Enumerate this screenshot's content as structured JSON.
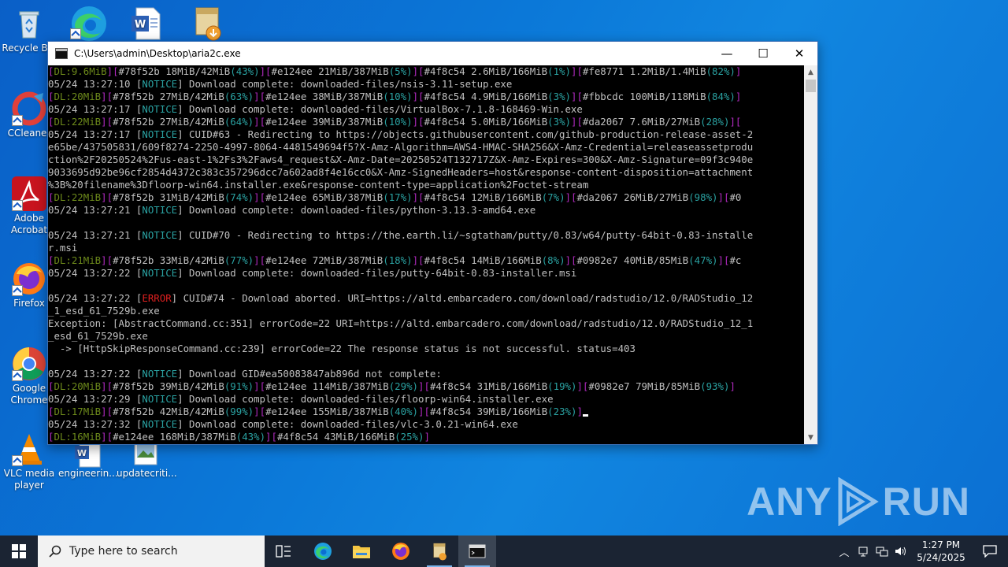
{
  "desktop_icons": [
    {
      "label": "Recycle Bin",
      "icon": "recycle-bin-icon"
    },
    {
      "label": "CCleaner",
      "icon": "ccleaner-icon"
    },
    {
      "label": "Adobe Acrobat",
      "icon": "adobe-acrobat-icon"
    },
    {
      "label": "Firefox",
      "icon": "firefox-icon"
    },
    {
      "label": "Google Chrome",
      "icon": "chrome-icon"
    },
    {
      "label": "VLC media player",
      "icon": "vlc-icon"
    },
    {
      "label": "engineerin...",
      "icon": "word-document-icon"
    },
    {
      "label": "updatecriti...",
      "icon": "image-file-icon"
    },
    {
      "label": "",
      "icon": "edge-icon"
    },
    {
      "label": "",
      "icon": "word-document-icon"
    },
    {
      "label": "",
      "icon": "installer-icon"
    }
  ],
  "window": {
    "title": "C:\\Users\\admin\\Desktop\\aria2c.exe",
    "minimize": "—",
    "maximize": "☐",
    "close": "✕"
  },
  "console_lines": [
    [
      [
        "sep",
        "["
      ],
      [
        "dl",
        "DL:9.6MiB"
      ],
      [
        "sep",
        "]["
      ],
      [
        "w",
        "#78f52b 18MiB/42MiB"
      ],
      [
        "g",
        "(43%)"
      ],
      [
        "sep",
        "]["
      ],
      [
        "w",
        "#e124ee 21MiB/387MiB"
      ],
      [
        "g",
        "(5%)"
      ],
      [
        "sep",
        "]["
      ],
      [
        "w",
        "#4f8c54 2.6MiB/166MiB"
      ],
      [
        "g",
        "(1%)"
      ],
      [
        "sep",
        "]["
      ],
      [
        "w",
        "#fe8771 1.2MiB/1.4MiB"
      ],
      [
        "g",
        "(82%)"
      ],
      [
        "sep",
        "]"
      ]
    ],
    [
      [
        "w",
        "05/24 13:27:10 ["
      ],
      [
        "tag",
        "NOTICE"
      ],
      [
        "w",
        "] Download complete: downloaded-files/nsis-3.11-setup.exe"
      ]
    ],
    [
      [
        "sep",
        "["
      ],
      [
        "dl",
        "DL:20MiB"
      ],
      [
        "sep",
        "]["
      ],
      [
        "w",
        "#78f52b 27MiB/42MiB"
      ],
      [
        "g",
        "(63%)"
      ],
      [
        "sep",
        "]["
      ],
      [
        "w",
        "#e124ee 38MiB/387MiB"
      ],
      [
        "g",
        "(10%)"
      ],
      [
        "sep",
        "]["
      ],
      [
        "w",
        "#4f8c54 4.9MiB/166MiB"
      ],
      [
        "g",
        "(3%)"
      ],
      [
        "sep",
        "]["
      ],
      [
        "w",
        "#fbbcdc 100MiB/118MiB"
      ],
      [
        "g",
        "(84%)"
      ],
      [
        "sep",
        "]"
      ]
    ],
    [
      [
        "w",
        "05/24 13:27:17 ["
      ],
      [
        "tag",
        "NOTICE"
      ],
      [
        "w",
        "] Download complete: downloaded-files/VirtualBox-7.1.8-168469-Win.exe"
      ]
    ],
    [
      [
        "sep",
        "["
      ],
      [
        "dl",
        "DL:22MiB"
      ],
      [
        "sep",
        "]["
      ],
      [
        "w",
        "#78f52b 27MiB/42MiB"
      ],
      [
        "g",
        "(64%)"
      ],
      [
        "sep",
        "]["
      ],
      [
        "w",
        "#e124ee 39MiB/387MiB"
      ],
      [
        "g",
        "(10%)"
      ],
      [
        "sep",
        "]["
      ],
      [
        "w",
        "#4f8c54 5.0MiB/166MiB"
      ],
      [
        "g",
        "(3%)"
      ],
      [
        "sep",
        "]["
      ],
      [
        "w",
        "#da2067 7.6MiB/27MiB"
      ],
      [
        "g",
        "(28%)"
      ],
      [
        "sep",
        "]["
      ]
    ],
    [
      [
        "w",
        "05/24 13:27:17 ["
      ],
      [
        "tag",
        "NOTICE"
      ],
      [
        "w",
        "] CUID#63 - Redirecting to https://objects.githubusercontent.com/github-production-release-asset-2"
      ]
    ],
    [
      [
        "w",
        "e65be/437505831/609f8274-2250-4997-8064-4481549694f5?X-Amz-Algorithm=AWS4-HMAC-SHA256&X-Amz-Credential=releaseassetprodu"
      ]
    ],
    [
      [
        "w",
        "ction%2F20250524%2Fus-east-1%2Fs3%2Faws4_request&X-Amz-Date=20250524T132717Z&X-Amz-Expires=300&X-Amz-Signature=09f3c940e"
      ]
    ],
    [
      [
        "w",
        "9033695d92be96cf2854d4372c383c357296dcc7a602ad8f4e16cc0&X-Amz-SignedHeaders=host&response-content-disposition=attachment"
      ]
    ],
    [
      [
        "w",
        "%3B%20filename%3Dfloorp-win64.installer.exe&response-content-type=application%2Foctet-stream"
      ]
    ],
    [
      [
        "sep",
        "["
      ],
      [
        "dl",
        "DL:22MiB"
      ],
      [
        "sep",
        "]["
      ],
      [
        "w",
        "#78f52b 31MiB/42MiB"
      ],
      [
        "g",
        "(74%)"
      ],
      [
        "sep",
        "]["
      ],
      [
        "w",
        "#e124ee 65MiB/387MiB"
      ],
      [
        "g",
        "(17%)"
      ],
      [
        "sep",
        "]["
      ],
      [
        "w",
        "#4f8c54 12MiB/166MiB"
      ],
      [
        "g",
        "(7%)"
      ],
      [
        "sep",
        "]["
      ],
      [
        "w",
        "#da2067 26MiB/27MiB"
      ],
      [
        "g",
        "(98%)"
      ],
      [
        "sep",
        "]["
      ],
      [
        "w",
        "#0"
      ]
    ],
    [
      [
        "w",
        "05/24 13:27:21 ["
      ],
      [
        "tag",
        "NOTICE"
      ],
      [
        "w",
        "] Download complete: downloaded-files/python-3.13.3-amd64.exe"
      ]
    ],
    [
      [
        "w",
        ""
      ]
    ],
    [
      [
        "w",
        "05/24 13:27:21 ["
      ],
      [
        "tag",
        "NOTICE"
      ],
      [
        "w",
        "] CUID#70 - Redirecting to https://the.earth.li/~sgtatham/putty/0.83/w64/putty-64bit-0.83-installe"
      ]
    ],
    [
      [
        "w",
        "r.msi"
      ]
    ],
    [
      [
        "sep",
        "["
      ],
      [
        "dl",
        "DL:21MiB"
      ],
      [
        "sep",
        "]["
      ],
      [
        "w",
        "#78f52b 33MiB/42MiB"
      ],
      [
        "g",
        "(77%)"
      ],
      [
        "sep",
        "]["
      ],
      [
        "w",
        "#e124ee 72MiB/387MiB"
      ],
      [
        "g",
        "(18%)"
      ],
      [
        "sep",
        "]["
      ],
      [
        "w",
        "#4f8c54 14MiB/166MiB"
      ],
      [
        "g",
        "(8%)"
      ],
      [
        "sep",
        "]["
      ],
      [
        "w",
        "#0982e7 40MiB/85MiB"
      ],
      [
        "g",
        "(47%)"
      ],
      [
        "sep",
        "]["
      ],
      [
        "w",
        "#c"
      ]
    ],
    [
      [
        "w",
        "05/24 13:27:22 ["
      ],
      [
        "tag",
        "NOTICE"
      ],
      [
        "w",
        "] Download complete: downloaded-files/putty-64bit-0.83-installer.msi"
      ]
    ],
    [
      [
        "w",
        ""
      ]
    ],
    [
      [
        "w",
        "05/24 13:27:22 ["
      ],
      [
        "err",
        "ERROR"
      ],
      [
        "w",
        "] CUID#74 - Download aborted. URI=https://altd.embarcadero.com/download/radstudio/12.0/RADStudio_12"
      ]
    ],
    [
      [
        "w",
        "_1_esd_61_7529b.exe"
      ]
    ],
    [
      [
        "w",
        "Exception: [AbstractCommand.cc:351] errorCode=22 URI=https://altd.embarcadero.com/download/radstudio/12.0/RADStudio_12_1"
      ]
    ],
    [
      [
        "w",
        "_esd_61_7529b.exe"
      ]
    ],
    [
      [
        "w",
        "  -> [HttpSkipResponseCommand.cc:239] errorCode=22 The response status is not successful. status=403"
      ]
    ],
    [
      [
        "w",
        ""
      ]
    ],
    [
      [
        "w",
        "05/24 13:27:22 ["
      ],
      [
        "tag",
        "NOTICE"
      ],
      [
        "w",
        "] Download GID#ea50083847ab896d not complete:"
      ]
    ],
    [
      [
        "sep",
        "["
      ],
      [
        "dl",
        "DL:20MiB"
      ],
      [
        "sep",
        "]["
      ],
      [
        "w",
        "#78f52b 39MiB/42MiB"
      ],
      [
        "g",
        "(91%)"
      ],
      [
        "sep",
        "]["
      ],
      [
        "w",
        "#e124ee 114MiB/387MiB"
      ],
      [
        "g",
        "(29%)"
      ],
      [
        "sep",
        "]["
      ],
      [
        "w",
        "#4f8c54 31MiB/166MiB"
      ],
      [
        "g",
        "(19%)"
      ],
      [
        "sep",
        "]["
      ],
      [
        "w",
        "#0982e7 79MiB/85MiB"
      ],
      [
        "g",
        "(93%)"
      ],
      [
        "sep",
        "]"
      ]
    ],
    [
      [
        "w",
        "05/24 13:27:29 ["
      ],
      [
        "tag",
        "NOTICE"
      ],
      [
        "w",
        "] Download complete: downloaded-files/floorp-win64.installer.exe"
      ]
    ],
    [
      [
        "sep",
        "["
      ],
      [
        "dl",
        "DL:17MiB"
      ],
      [
        "sep",
        "]["
      ],
      [
        "w",
        "#78f52b 42MiB/42MiB"
      ],
      [
        "g",
        "(99%)"
      ],
      [
        "sep",
        "]["
      ],
      [
        "w",
        "#e124ee 155MiB/387MiB"
      ],
      [
        "g",
        "(40%)"
      ],
      [
        "sep",
        "]["
      ],
      [
        "w",
        "#4f8c54 39MiB/166MiB"
      ],
      [
        "g",
        "(23%)"
      ],
      [
        "sep",
        "]"
      ],
      [
        "cursor",
        ""
      ]
    ],
    [
      [
        "w",
        "05/24 13:27:32 ["
      ],
      [
        "tag",
        "NOTICE"
      ],
      [
        "w",
        "] Download complete: downloaded-files/vlc-3.0.21-win64.exe"
      ]
    ],
    [
      [
        "sep",
        "["
      ],
      [
        "dl",
        "DL:16MiB"
      ],
      [
        "sep",
        "]["
      ],
      [
        "w",
        "#e124ee 168MiB/387MiB"
      ],
      [
        "g",
        "(43%)"
      ],
      [
        "sep",
        "]["
      ],
      [
        "w",
        "#4f8c54 43MiB/166MiB"
      ],
      [
        "g",
        "(25%)"
      ],
      [
        "sep",
        "]"
      ]
    ]
  ],
  "taskbar": {
    "search_placeholder": "Type here to search",
    "clock_time": "1:27 PM",
    "clock_date": "5/24/2025"
  },
  "watermark": {
    "left": "ANY",
    "right": "RUN"
  },
  "colors": {
    "desktop": "#0b78d8",
    "taskbar": "#1b2433",
    "console_bg": "#000000",
    "console_text": "#c0c0c0",
    "notice": "#2aa1a1",
    "error": "#e02020",
    "dl": "#6d8a1b",
    "separator": "#b02abf"
  }
}
